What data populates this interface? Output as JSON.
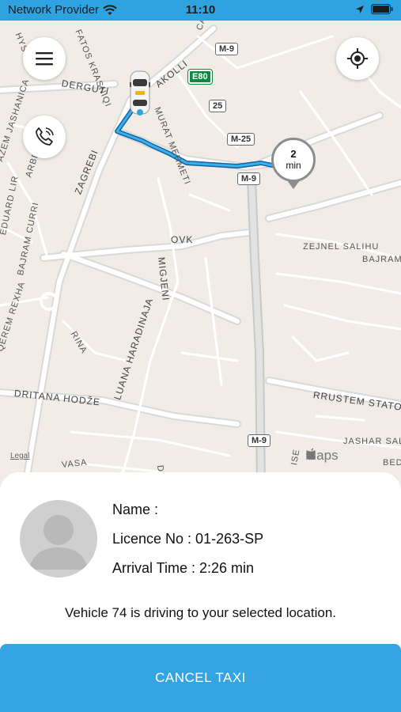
{
  "status_bar": {
    "carrier": "Network Provider",
    "time": "11:10"
  },
  "map": {
    "streets": {
      "derguti": "DERGUTI",
      "zagrebi": "ZAGREBI",
      "akolli": "AKOLLI",
      "fatos": "FATOS KRASNIQI",
      "murat": "MURAT MEHMETI",
      "ovk": "OVK",
      "migjeni": "MIGJENI",
      "luana": "LUANA HARADINAJA",
      "dritana": "DRITANA HODŽE",
      "rrustem": "RRUSTEM STATOVCI",
      "zejnel": "ZEJNEL SALIHU",
      "bajram_k": "BAJRAM K",
      "jashar": "JASHAR SALIHU",
      "eduard": "EDUARD LIR",
      "bajram_curri": "BAJRAM CURRI",
      "azem": "AZEM JASHANICA",
      "arbe": "ARBE",
      "rina": "RINA",
      "vasa": "VASA",
      "bedr": "BEDR",
      "ise": "ISE",
      "carr": "CARR",
      "hys": "HYS P",
      "qerem": "QEREM REXHA",
      "dz": "DŽO"
    },
    "shields": {
      "m9_top": "M-9",
      "e80": "E80",
      "r25": "25",
      "m25": "M-25",
      "m9_mid": "M-9",
      "m9_bottom": "M-9"
    },
    "eta_value": "2",
    "eta_unit": "min",
    "legal_label": "Legal",
    "maps_label": "Maps",
    "route_color": "#1f8fd6"
  },
  "driver": {
    "name_label": "Name :",
    "licence_label": "Licence No : 01-263-SP",
    "arrival_label": "Arrival Time : 2:26 min"
  },
  "message": "Vehicle 74 is driving to your selected location.",
  "cancel_button": "CANCEL TAXI",
  "icons": {
    "menu": "hamburger-menu-icon",
    "phone": "phone-ringing-icon",
    "locate": "crosshair-locate-icon",
    "car": "taxi-car-icon"
  }
}
